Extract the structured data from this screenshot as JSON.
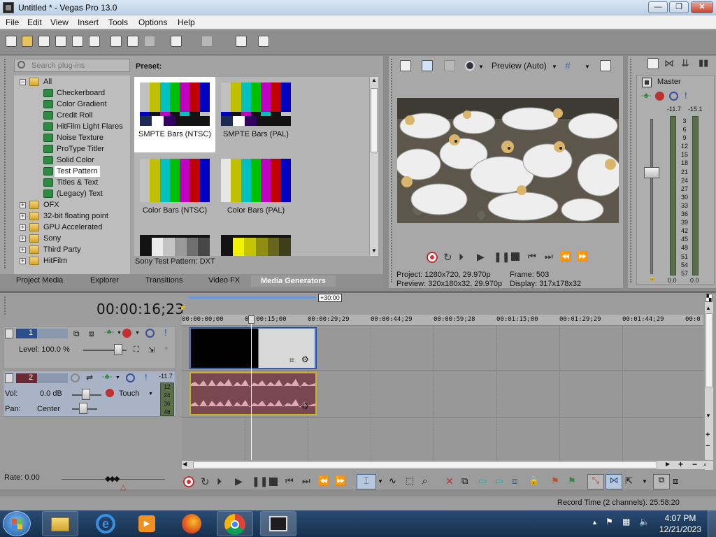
{
  "window": {
    "title": "Untitled * - Vegas Pro 13.0",
    "min": "—",
    "max": "❐",
    "close": "✕"
  },
  "menu": [
    "File",
    "Edit",
    "View",
    "Insert",
    "Tools",
    "Options",
    "Help"
  ],
  "explorer": {
    "search_placeholder": "Search plug-ins",
    "tree": {
      "root": "All",
      "items": [
        "Checkerboard",
        "Color Gradient",
        "Credit Roll",
        "HitFilm Light Flares",
        "Noise Texture",
        "ProType Titler",
        "Solid Color",
        "Test Pattern",
        "Titles & Text",
        "(Legacy) Text"
      ],
      "selected": "Test Pattern",
      "folders": [
        "OFX",
        "32-bit floating point",
        "GPU Accelerated",
        "Sony",
        "Third Party",
        "HitFilm"
      ]
    },
    "preset_label": "Preset:",
    "presets": [
      "SMPTE Bars (NTSC)",
      "SMPTE Bars (PAL)",
      "Color Bars (NTSC)",
      "Color Bars (PAL)"
    ],
    "status": "Sony Test Pattern: DXT",
    "tabs": [
      "Project Media",
      "Explorer",
      "Transitions",
      "Video FX",
      "Media Generators"
    ],
    "active_tab": "Media Generators"
  },
  "preview": {
    "mode": "Preview (Auto)",
    "project_label": "Project:",
    "project": "1280x720, 29.970p",
    "frame_label": "Frame:",
    "frame": "503",
    "preview_label": "Preview:",
    "preview_val": "320x180x32, 29.970p",
    "display_label": "Display:",
    "display": "317x178x32"
  },
  "mixer": {
    "label": "Master",
    "peak_left": "-11.7",
    "peak_right": "-15.1",
    "scale": [
      "3",
      "6",
      "9",
      "12",
      "15",
      "18",
      "21",
      "24",
      "27",
      "30",
      "33",
      "36",
      "39",
      "42",
      "45",
      "48",
      "51",
      "54",
      "57"
    ],
    "bottom_left": "0.0",
    "bottom_right": "0.0"
  },
  "timeline": {
    "timecode": "00:00:16;23",
    "region": "+30:00",
    "ruler": [
      "00:00:00;00",
      "00:00:15;00",
      "00:00:29;29",
      "00:00:44;29",
      "00:00:59;28",
      "00:01:15;00",
      "00:01:29;29",
      "00:01:44;29",
      "00:0"
    ],
    "video_track": {
      "number": "1",
      "level": "Level: 100.0 %"
    },
    "audio_track": {
      "number": "2",
      "vol_label": "Vol:",
      "vol": "0.0 dB",
      "pan_label": "Pan:",
      "pan": "Center",
      "touch": "Touch",
      "meter_peak": "-11.7",
      "meter_scale": [
        "12",
        "24",
        "36",
        "48"
      ]
    }
  },
  "transport": {
    "rate": "Rate: 0.00"
  },
  "status": {
    "record_time": "Record Time (2 channels): 25:58:20"
  },
  "taskbar": {
    "time": "4:07 PM",
    "date": "12/21/2023"
  },
  "colors": {
    "accent": "#3b6fb0",
    "selected_event": "#4a78c8",
    "audio_event": "#7a4650",
    "record_red": "#d03030"
  }
}
